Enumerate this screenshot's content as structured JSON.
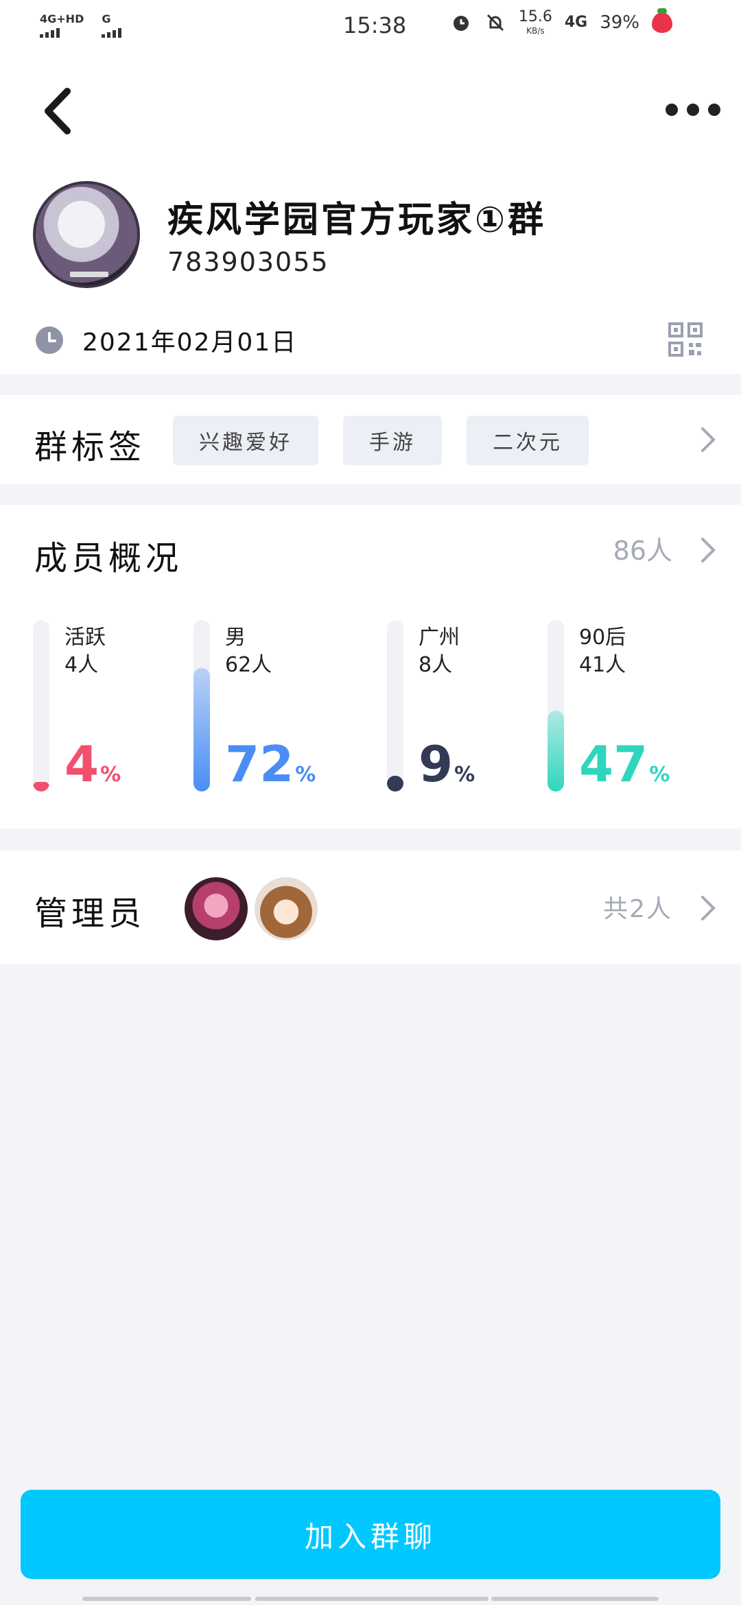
{
  "status_bar": {
    "signal_1": "4G+HD",
    "signal_2": "G",
    "time": "15:38",
    "net_speed_value": "15.6",
    "net_speed_unit": "KB/s",
    "network": "4G",
    "battery": "39%"
  },
  "header": {
    "group_name": "疾风学园官方玩家①群",
    "group_id": "783903055",
    "created_date": "2021年02月01日"
  },
  "tags": {
    "title": "群标签",
    "items": [
      "兴趣爱好",
      "手游",
      "二次元"
    ]
  },
  "members": {
    "title": "成员概况",
    "total": "86人",
    "stats": [
      {
        "label": "活跃",
        "count": "4人",
        "percent": "4",
        "pct_suffix": "%",
        "ratio": 0.04,
        "color": "#f0506e"
      },
      {
        "label": "男",
        "count": "62人",
        "percent": "72",
        "pct_suffix": "%",
        "ratio": 0.72,
        "color": "#4a8ef5"
      },
      {
        "label": "广州",
        "count": "8人",
        "percent": "9",
        "pct_suffix": "%",
        "ratio": 0.09,
        "color": "#333a55"
      },
      {
        "label": "90后",
        "count": "41人",
        "percent": "47",
        "pct_suffix": "%",
        "ratio": 0.47,
        "color": "#2fd6bd"
      }
    ]
  },
  "admins": {
    "title": "管理员",
    "count": "共2人"
  },
  "join_button": "加入群聊",
  "colors": {
    "accent": "#00c8ff",
    "background": "#f3f4f8",
    "muted": "#a6a9b6"
  }
}
